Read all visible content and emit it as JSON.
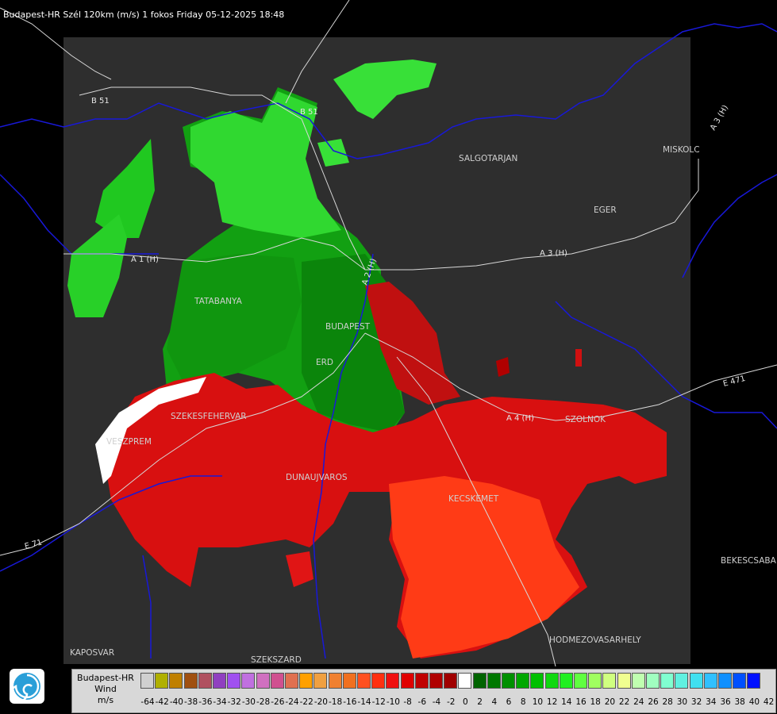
{
  "title": "Budapest-HR Szél 120km (m/s) 1 fokos Friday 05-12-2025 18:48",
  "cities": [
    "SALGOTARJAN",
    "MISKOLC",
    "EGER",
    "TATABANYA",
    "BUDAPEST",
    "ERD",
    "SZEKESFEHERVAR",
    "VESZPREM",
    "DUNAUJVAROS",
    "KECSKEMET",
    "SZOLNOK",
    "BEKESCSABA",
    "HODMEZOVASARHELY",
    "KAPOSVAR",
    "SZEKSZARD"
  ],
  "roads": [
    "B 51",
    "B 51",
    "A 3 (H)",
    "A 3 (H)",
    "A 2 (H)",
    "A 4 (H)",
    "E 471",
    "E 71",
    "A 1 (H)"
  ],
  "legend": {
    "title_lines": [
      "Budapest-HR",
      "Wind",
      "m/s"
    ],
    "labels": [
      "-64",
      "-42",
      "-40",
      "-38",
      "-36",
      "-34",
      "-32",
      "-30",
      "-28",
      "-26",
      "-24",
      "-22",
      "-20",
      "-18",
      "-16",
      "-14",
      "-12",
      "-10",
      "-8",
      "-6",
      "-4",
      "-2",
      "0",
      "2",
      "4",
      "6",
      "8",
      "10",
      "12",
      "14",
      "16",
      "18",
      "20",
      "22",
      "24",
      "26",
      "28",
      "30",
      "32",
      "34",
      "36",
      "38",
      "40",
      "42"
    ],
    "colors": [
      "#d0d0d0",
      "#b0b000",
      "#c08000",
      "#a05010",
      "#b05060",
      "#9040c0",
      "#a050f0",
      "#c070e0",
      "#d070c0",
      "#d05090",
      "#e07050",
      "#ffa000",
      "#f0a040",
      "#f08030",
      "#f07020",
      "#ff5020",
      "#ff3010",
      "#f01010",
      "#e00000",
      "#c00000",
      "#b00000",
      "#a00000",
      "#ffffff",
      "#006400",
      "#007800",
      "#009000",
      "#00a800",
      "#00c000",
      "#10d810",
      "#20f020",
      "#60ff40",
      "#a0ff60",
      "#d0ff80",
      "#f0ff90",
      "#c0ffb0",
      "#a0ffc0",
      "#80ffd0",
      "#60f0e0",
      "#40e0f0",
      "#30c0ff",
      "#1090ff",
      "#0050ff",
      "#0010ff"
    ]
  },
  "colors": {
    "frame_bg": "#2e2e2e",
    "outside_bg": "#000000",
    "border": "#1010d0",
    "roads": "#e0e0e0",
    "green_dark": "#0a8a0a",
    "green_light": "#30e030",
    "red_dark": "#c81010",
    "red_light": "#ff3010"
  }
}
